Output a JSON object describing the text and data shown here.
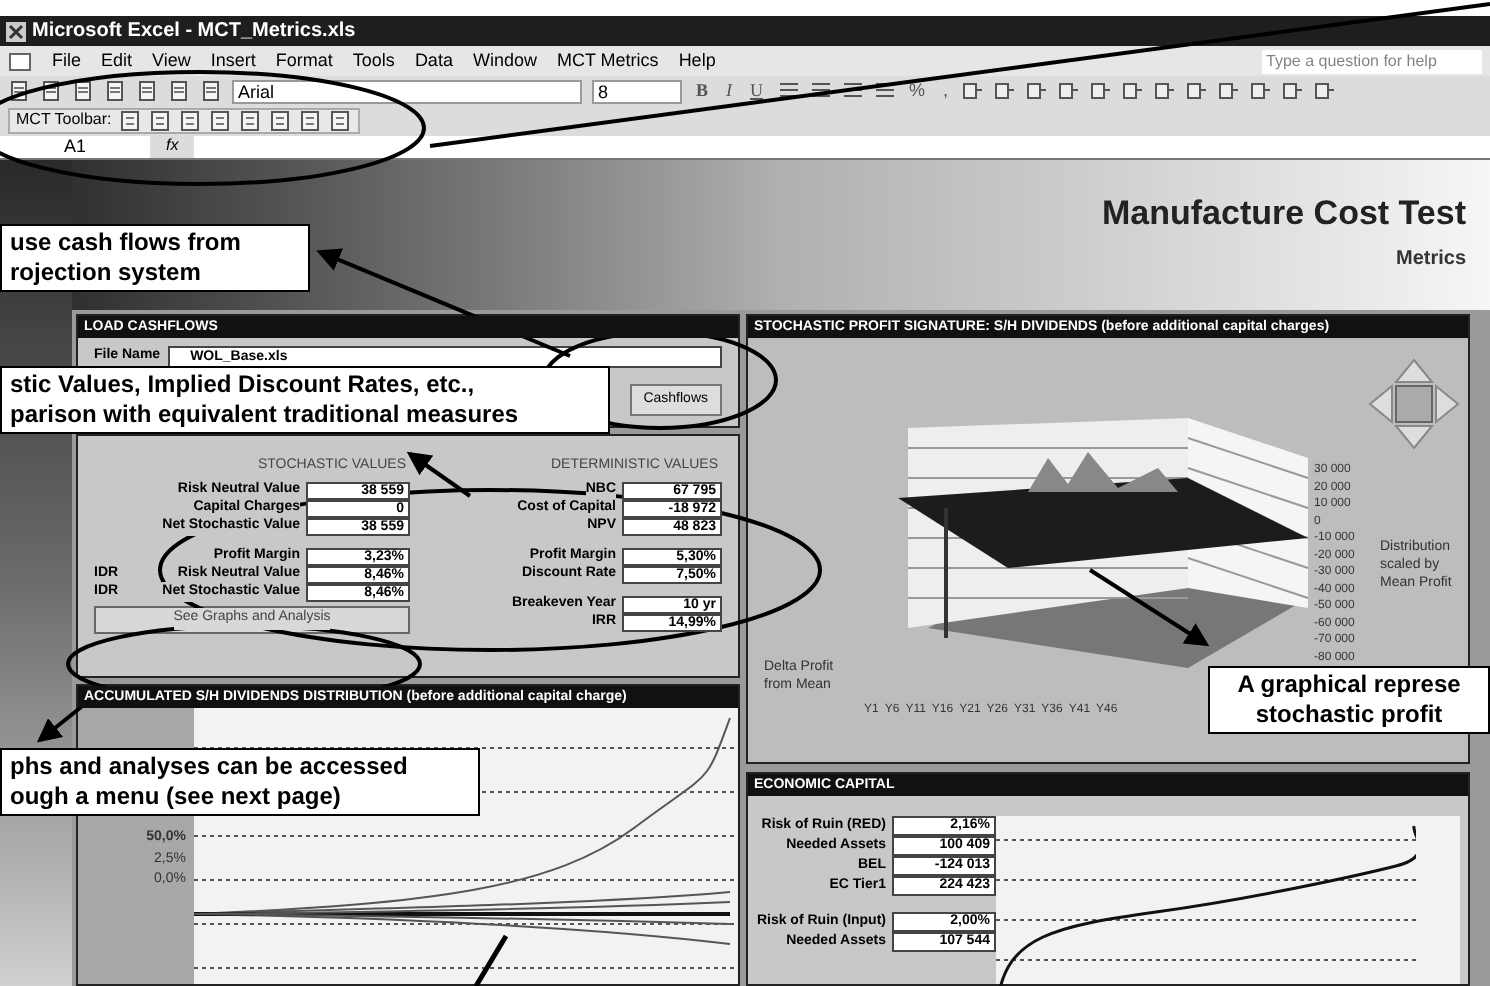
{
  "window": {
    "title": "Microsoft Excel - MCT_Metrics.xls"
  },
  "menu": [
    "File",
    "Edit",
    "View",
    "Insert",
    "Format",
    "Tools",
    "Data",
    "Window",
    "MCT Metrics",
    "Help"
  ],
  "help_search": {
    "placeholder": "Type a question for help"
  },
  "toolbar": {
    "font": "Arial",
    "size": "8",
    "format_buttons": [
      "B",
      "I",
      "U"
    ],
    "number_buttons": [
      "%",
      ","
    ]
  },
  "mct_toolbar": {
    "label": "MCT Toolbar:"
  },
  "formula_bar": {
    "cell": "A1",
    "fx": "fx"
  },
  "header": {
    "title": "Manufacture Cost Test",
    "subtitle": "Metrics"
  },
  "load_panel": {
    "title": "LOAD CASHFLOWS",
    "file_label": "File Name",
    "file": "WOL_Base.xls",
    "button": "Cashflows"
  },
  "values_panel": {
    "stochastic_heading": "STOCHASTIC VALUES",
    "deterministic_heading": "DETERMINISTIC VALUES",
    "stochastic": [
      {
        "label": "Risk Neutral Value",
        "value": "38 559"
      },
      {
        "label": "Capital Charges",
        "value": "0"
      },
      {
        "label": "Net Stochastic Value",
        "value": "38 559",
        "gap_after": true
      },
      {
        "label": "Profit Margin",
        "value": "3,23%"
      },
      {
        "prefix": "IDR",
        "label": "Risk Neutral Value",
        "value": "8,46%"
      },
      {
        "prefix": "IDR",
        "label": "Net Stochastic Value",
        "value": "8,46%"
      }
    ],
    "deterministic": [
      {
        "label": "NBC",
        "value": "67 795"
      },
      {
        "label": "Cost of Capital",
        "value": "-18 972"
      },
      {
        "label": "NPV",
        "value": "48 823",
        "gap_after": true
      },
      {
        "label": "Profit Margin",
        "value": "5,30%"
      },
      {
        "label": "Discount Rate",
        "value": "7,50%",
        "gap_after": true
      },
      {
        "label": "Breakeven Year",
        "value": "10 yr"
      },
      {
        "label": "IRR",
        "value": "14,99%"
      }
    ],
    "button": "See Graphs and Analysis"
  },
  "signature_panel": {
    "title": "STOCHASTIC PROFIT SIGNATURE: S/H DIVIDENDS (before additional capital charges)",
    "z_ticks": [
      "30 000",
      "20 000",
      "10 000",
      "0",
      "-10 000",
      "-20 000",
      "-30 000",
      "-40 000",
      "-50 000",
      "-60 000",
      "-70 000",
      "-80 000"
    ],
    "z_note": "Distribution scaled by Mean Profit",
    "depth_label": "Delta Profit from Mean",
    "x_ticks": [
      "Y1",
      "Y6",
      "Y11",
      "Y16",
      "Y21",
      "Y26",
      "Y31",
      "Y36",
      "Y41",
      "Y46"
    ]
  },
  "accumulated_panel": {
    "title": "ACCUMULATED S/H DIVIDENDS DISTRIBUTION (before additional capital charge)",
    "y_labels": [
      "50,0%",
      "2,5%",
      "0,0%"
    ]
  },
  "economic_panel": {
    "title": "ECONOMIC CAPITAL",
    "rows": [
      {
        "label": "Risk of Ruin (RED)",
        "value": "2,16%"
      },
      {
        "label": "Needed Assets",
        "value": "100 409"
      },
      {
        "label": "BEL",
        "value": "-124 013"
      },
      {
        "label": "EC Tier1",
        "value": "224 423",
        "gap_after": true
      },
      {
        "label": "Risk of Ruin (Input)",
        "value": "2,00%"
      },
      {
        "label": "Needed Assets",
        "value": "107 544"
      }
    ]
  },
  "callouts": [
    {
      "lines": [
        "use cash flows from",
        "rojection system"
      ]
    },
    {
      "lines": [
        "stic Values, Implied Discount Rates, etc.,",
        "parison with equivalent traditional measures"
      ]
    },
    {
      "lines": [
        "phs and analyses can be accessed",
        "ough a menu (see next page)"
      ]
    },
    {
      "lines": [
        "A graphical represe",
        "stochastic profit"
      ]
    }
  ]
}
